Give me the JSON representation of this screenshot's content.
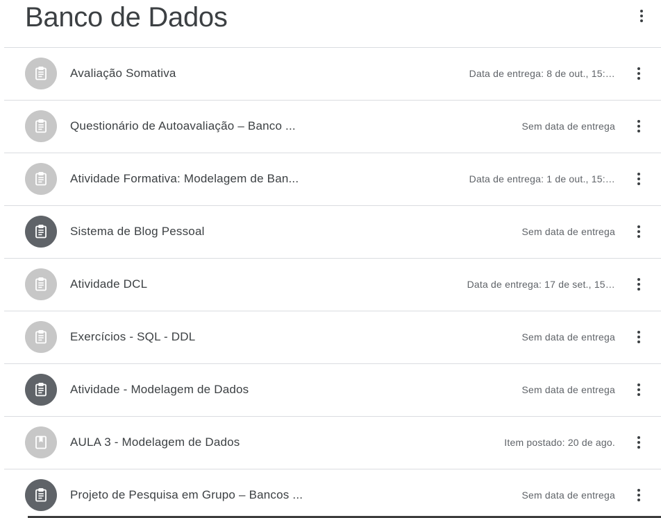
{
  "header": {
    "title": "Banco de Dados",
    "more_icon": "more-vert-icon"
  },
  "items": [
    {
      "title": "Avaliação Somativa",
      "meta": "Data de entrega: 8 de out., 15:…",
      "icon": "assignment-icon",
      "style": "light"
    },
    {
      "title": "Questionário de Autoavaliação – Banco ...",
      "meta": "Sem data de entrega",
      "icon": "assignment-icon",
      "style": "light"
    },
    {
      "title": "Atividade Formativa: Modelagem de Ban...",
      "meta": "Data de entrega: 1 de out., 15:…",
      "icon": "assignment-icon",
      "style": "light"
    },
    {
      "title": "Sistema de Blog Pessoal",
      "meta": "Sem data de entrega",
      "icon": "assignment-icon",
      "style": "dark"
    },
    {
      "title": "Atividade DCL",
      "meta": "Data de entrega: 17 de set., 15…",
      "icon": "assignment-icon",
      "style": "light"
    },
    {
      "title": "Exercícios - SQL - DDL",
      "meta": "Sem data de entrega",
      "icon": "assignment-icon",
      "style": "light"
    },
    {
      "title": "Atividade - Modelagem de Dados",
      "meta": "Sem data de entrega",
      "icon": "assignment-icon",
      "style": "dark"
    },
    {
      "title": "AULA 3 - Modelagem de Dados",
      "meta": "Item postado: 20 de ago.",
      "icon": "material-icon",
      "style": "light"
    },
    {
      "title": "Projeto de Pesquisa em Grupo – Bancos ...",
      "meta": "Sem data de entrega",
      "icon": "assignment-icon",
      "style": "dark"
    }
  ]
}
